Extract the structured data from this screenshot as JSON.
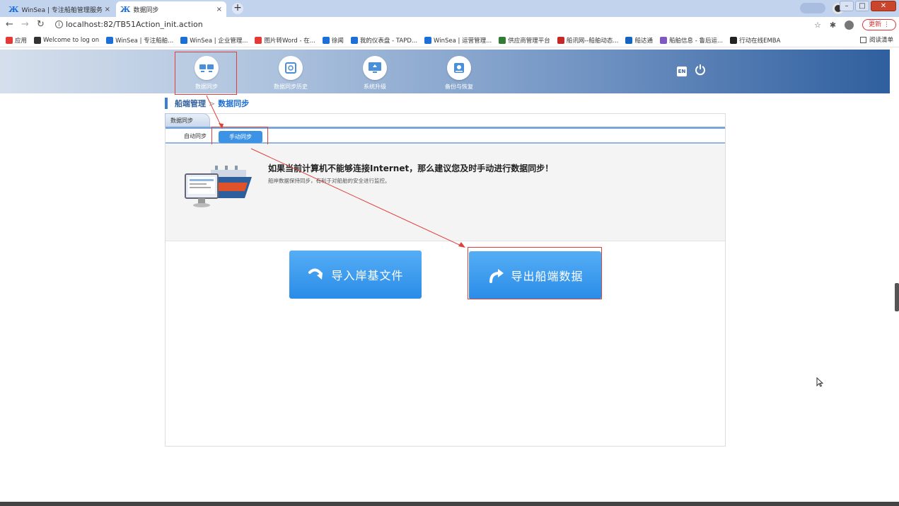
{
  "browser": {
    "tabs": [
      {
        "title": "WinSea | 专注船舶管理服务",
        "icon": "winsea-logo-icon",
        "close": "×"
      },
      {
        "title": "数据同步",
        "icon": "winsea-logo-icon",
        "close": "×"
      }
    ],
    "new_tab": "+",
    "url": "localhost:82/TB51Action_init.action",
    "update_label": "更新",
    "bookmarks": [
      {
        "label": "应用",
        "color": "#e53935"
      },
      {
        "label": "Welcome to log on",
        "color": "#333333"
      },
      {
        "label": "WinSea | 专注船舶...",
        "color": "#1b6fd6"
      },
      {
        "label": "WinSea | 企业管理...",
        "color": "#1b6fd6"
      },
      {
        "label": "图片转Word - 在...",
        "color": "#e53935"
      },
      {
        "label": "徐闻",
        "color": "#1b6fd6"
      },
      {
        "label": "我的仪表盘 - TAPD...",
        "color": "#1b6fd6"
      },
      {
        "label": "WinSea | 运营管理...",
        "color": "#1b6fd6"
      },
      {
        "label": "供应商管理平台",
        "color": "#2e7d32"
      },
      {
        "label": "船讯网--船舶动态...",
        "color": "#c62828"
      },
      {
        "label": "船达通",
        "color": "#1565c0"
      },
      {
        "label": "船舶信息 - 鲁后运...",
        "color": "#7e57c2"
      },
      {
        "label": "行动在线EMBA",
        "color": "#222222"
      }
    ],
    "reading_list": "阅读清单"
  },
  "header": {
    "nav": [
      {
        "label": "数据同步",
        "icon": "monitors-sync-icon"
      },
      {
        "label": "数据同步历史",
        "icon": "history-icon"
      },
      {
        "label": "系统升级",
        "icon": "monitor-upgrade-icon"
      },
      {
        "label": "备份与恢复",
        "icon": "disk-backup-icon"
      }
    ],
    "lang": "EN",
    "power_icon": "power-icon"
  },
  "breadcrumb": {
    "first": "船端管理",
    "sep": ">",
    "second": "数据同步"
  },
  "panel": {
    "tab_label": "数据同步",
    "subtabs": {
      "auto": "自动同步",
      "manual": "手动同步"
    },
    "info_title": "如果当前计算机不能够连接Internet，那么建议您及时手动进行数据同步！",
    "info_sub": "船岸数据保持同步，有利于对船舶的安全进行监控。",
    "import_label": "导入岸基文件",
    "export_label": "导出船端数据"
  },
  "colors": {
    "accent": "#3c93e6",
    "header_dark": "#2f5f9e",
    "highlight_red": "#e0403a"
  }
}
